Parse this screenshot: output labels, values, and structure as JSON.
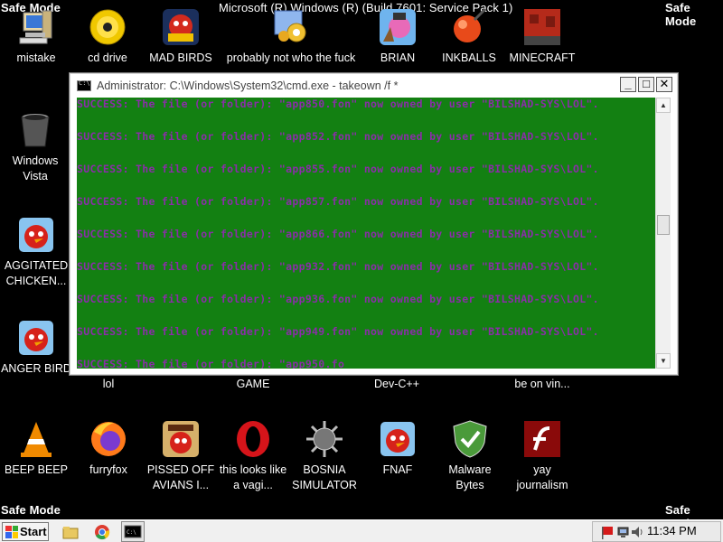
{
  "desktop": {
    "watermark": "Safe Mode",
    "title_overlay": "Microsoft (R) Windows (R) (Build 7601: Service Pack 1)",
    "icons": [
      {
        "label": "mistake",
        "icon": "computer-icon"
      },
      {
        "label": "cd drive",
        "icon": "cd-drive-icon"
      },
      {
        "label": "MAD BIRDS",
        "icon": "angry-birds-space-icon"
      },
      {
        "label": "probably not who the fuck",
        "icon": "control-panel-icon"
      },
      {
        "label": "BRIAN",
        "icon": "bird-slingshot-icon"
      },
      {
        "label": "INKBALLS",
        "icon": "inkball-icon"
      },
      {
        "label": "MINECRAFT",
        "icon": "minecraft-icon"
      },
      {
        "label": "Windows Vista",
        "icon": "recycle-bin-icon"
      },
      {
        "label": "AGGITATED CHICKEN...",
        "icon": "angry-birds-icon"
      },
      {
        "label": "ANGER BIRD",
        "icon": "angry-birds-icon"
      },
      {
        "label": "lol",
        "icon": "hidden-icon"
      },
      {
        "label": "GAME",
        "icon": "hidden-icon"
      },
      {
        "label": "Dev-C++",
        "icon": "hidden-icon"
      },
      {
        "label": "be on vin...",
        "icon": "hidden-icon"
      },
      {
        "label": "BEEP BEEP",
        "icon": "vlc-icon"
      },
      {
        "label": "furryfox",
        "icon": "firefox-icon"
      },
      {
        "label": "PISSED OFF AVIANS I...",
        "icon": "angry-birds-seasons-icon"
      },
      {
        "label": "this looks like a vagi...",
        "icon": "opera-icon"
      },
      {
        "label": "BOSNIA SIMULATOR",
        "icon": "spiked-ball-icon"
      },
      {
        "label": "FNAF",
        "icon": "angry-birds-icon"
      },
      {
        "label": "Malware Bytes",
        "icon": "shield-check-icon"
      },
      {
        "label": "yay journalism",
        "icon": "flash-icon"
      }
    ]
  },
  "cmd_window": {
    "title": "Administrator: C:\\Windows\\System32\\cmd.exe - takeown /f *",
    "buttons": {
      "minimize": "_",
      "maximize": "□",
      "close": "✕"
    },
    "lines": [
      "SUCCESS: The file (or folder): \"app850.fon\" now owned by user \"BILSHAD-SYS\\LOL\".",
      "SUCCESS: The file (or folder): \"app852.fon\" now owned by user \"BILSHAD-SYS\\LOL\".",
      "SUCCESS: The file (or folder): \"app855.fon\" now owned by user \"BILSHAD-SYS\\LOL\".",
      "SUCCESS: The file (or folder): \"app857.fon\" now owned by user \"BILSHAD-SYS\\LOL\".",
      "SUCCESS: The file (or folder): \"app866.fon\" now owned by user \"BILSHAD-SYS\\LOL\".",
      "SUCCESS: The file (or folder): \"app932.fon\" now owned by user \"BILSHAD-SYS\\LOL\".",
      "SUCCESS: The file (or folder): \"app936.fon\" now owned by user \"BILSHAD-SYS\\LOL\".",
      "SUCCESS: The file (or folder): \"app949.fon\" now owned by user \"BILSHAD-SYS\\LOL\".",
      "SUCCESS: The file (or folder): \"app950.fo"
    ],
    "colors": {
      "background": "#138012",
      "text": "#8a2da8"
    }
  },
  "taskbar": {
    "start_label": "Start",
    "clock": "11:34 PM",
    "pinned": [
      "explorer-icon",
      "chrome-icon",
      "cmd-icon"
    ],
    "tray": [
      "action-center-flag-icon",
      "network-icon",
      "volume-icon"
    ]
  }
}
